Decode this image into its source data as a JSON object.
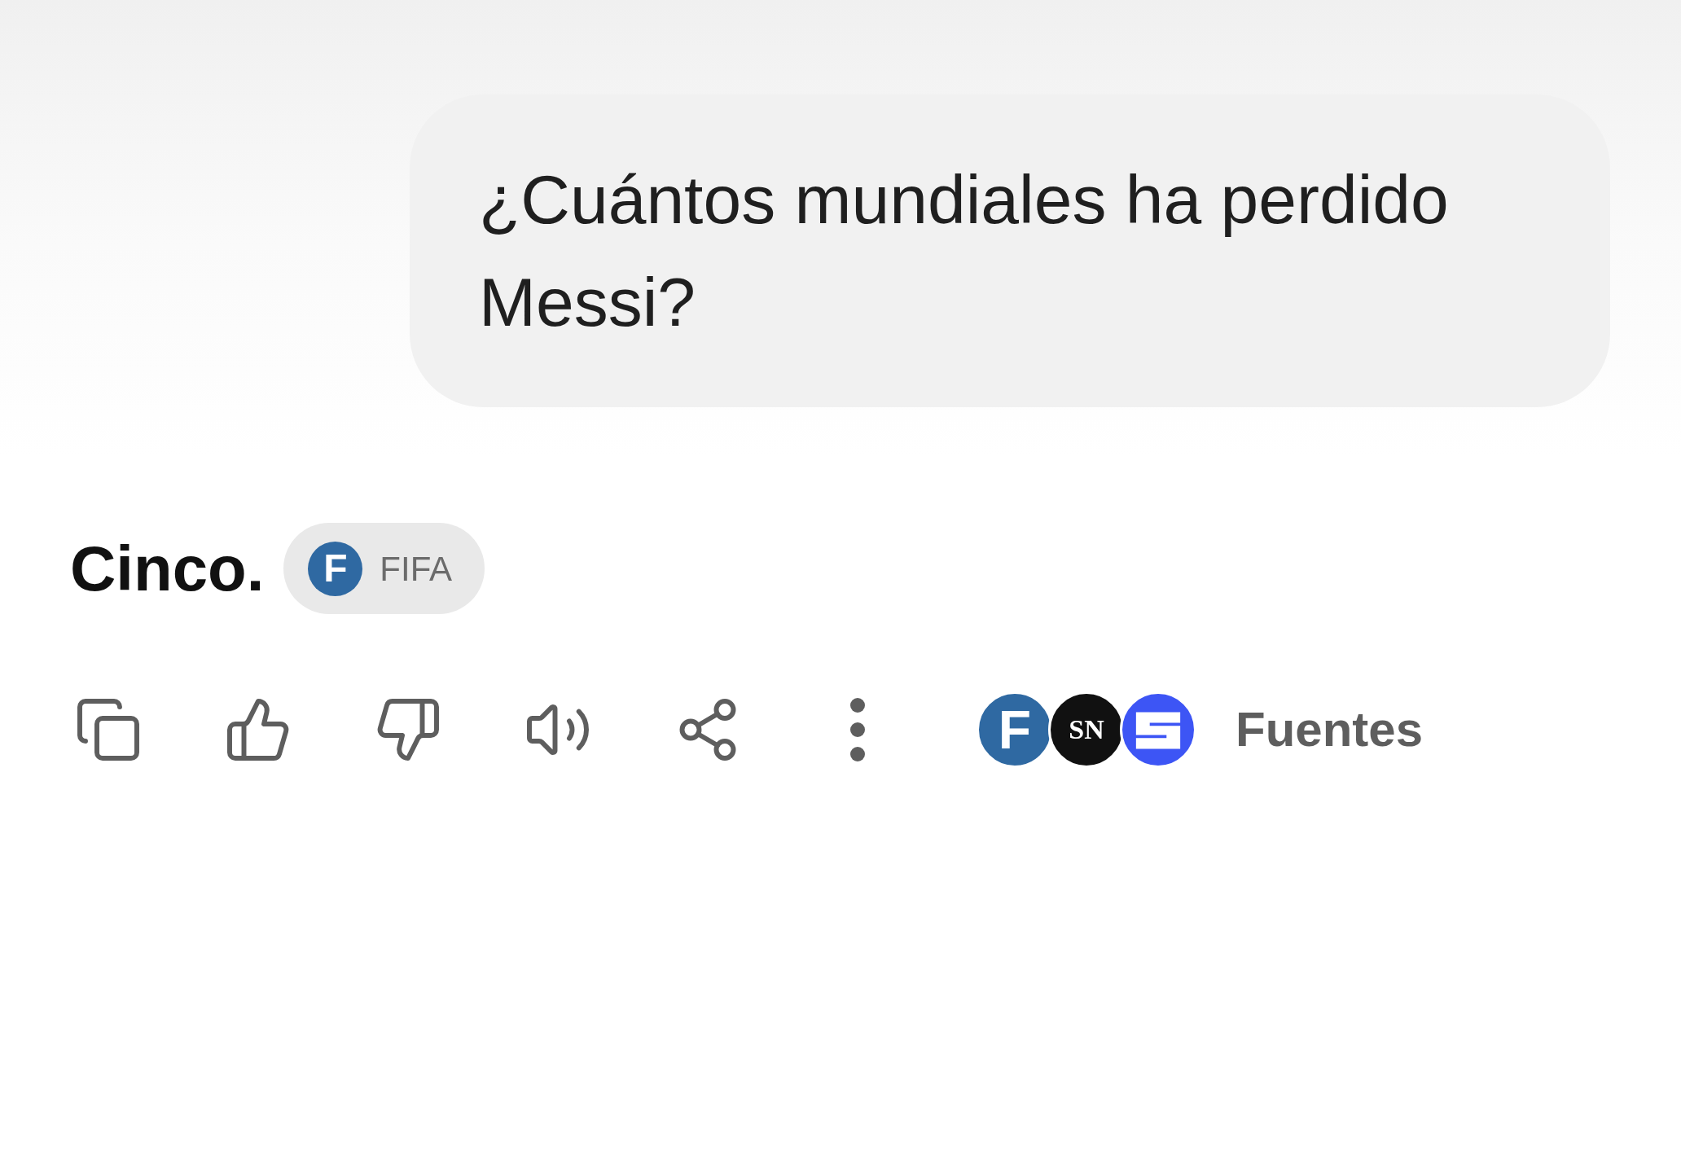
{
  "user_message": {
    "text": "¿Cuántos mundiales ha perdido Messi?"
  },
  "answer": {
    "text": "Cinco.",
    "source_chip": {
      "logo_letter": "F",
      "label": "FIFA"
    }
  },
  "sources": {
    "logos": [
      {
        "kind": "sans",
        "letter": "F",
        "color": "#2f69a2"
      },
      {
        "kind": "serif",
        "letter": "SN",
        "color": "#111111"
      },
      {
        "kind": "mark",
        "color": "#3d55f5"
      }
    ],
    "label": "Fuentes"
  }
}
